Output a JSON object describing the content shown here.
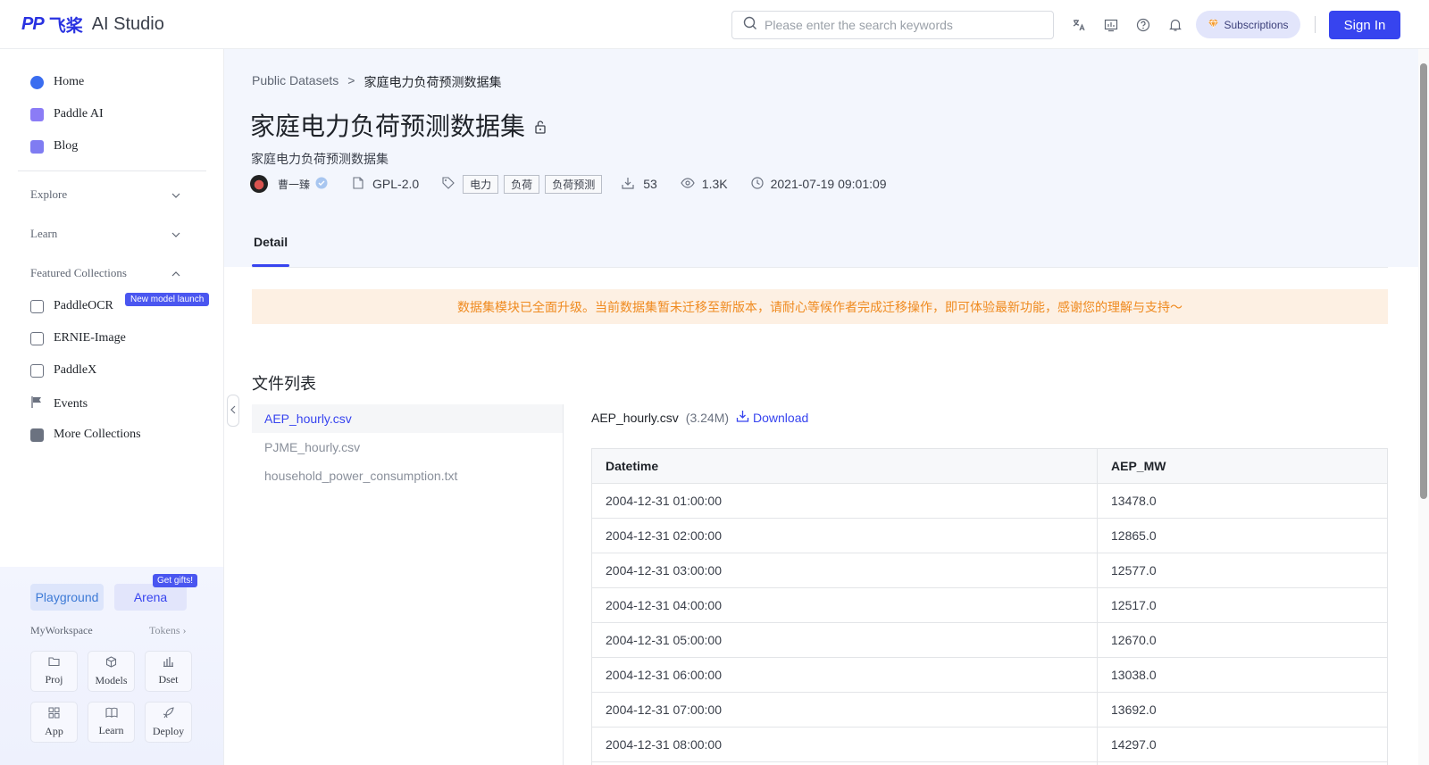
{
  "header": {
    "logo_mark": "PP",
    "logo_cn": "飞桨",
    "logo_studio": "AI Studio",
    "search_placeholder": "Please enter the search keywords",
    "subscriptions_label": "Subscriptions",
    "signin_label": "Sign In"
  },
  "sidebar": {
    "top_items": [
      {
        "label": "Home",
        "icon": "home-icon",
        "color": "#3a6df0"
      },
      {
        "label": "Paddle AI",
        "icon": "paddle-ai-icon",
        "color": "#7b6cf6"
      },
      {
        "label": "Blog",
        "icon": "blog-icon",
        "color": "#6f6cf0"
      }
    ],
    "sections": [
      {
        "label": "Explore",
        "expanded": false
      },
      {
        "label": "Learn",
        "expanded": false
      },
      {
        "label": "Featured Collections",
        "expanded": true
      }
    ],
    "collections": [
      {
        "label": "PaddleOCR",
        "icon": "ocr-icon",
        "badge": "New model launch"
      },
      {
        "label": "ERNIE-Image",
        "icon": "image-icon"
      },
      {
        "label": "PaddleX",
        "icon": "paddlex-icon"
      },
      {
        "label": "Events",
        "icon": "flag-icon"
      },
      {
        "label": "More Collections",
        "icon": "collections-icon"
      }
    ],
    "playground_label": "Playground",
    "arena_label": "Arena",
    "gifts_badge": "Get gifts!",
    "workspace_label": "MyWorkspace",
    "tokens_label": "Tokens",
    "tiles": [
      {
        "label": "Proj",
        "icon": "folder-icon"
      },
      {
        "label": "Models",
        "icon": "cube-icon"
      },
      {
        "label": "Dset",
        "icon": "bar-chart-icon"
      },
      {
        "label": "App",
        "icon": "apps-icon"
      },
      {
        "label": "Learn",
        "icon": "book-icon"
      },
      {
        "label": "Deploy",
        "icon": "rocket-icon"
      }
    ]
  },
  "dataset": {
    "breadcrumb_root": "Public Datasets",
    "breadcrumb_sep": ">",
    "breadcrumb_current": "家庭电力负荷预测数据集",
    "title": "家庭电力负荷预测数据集",
    "subtitle": "家庭电力负荷预测数据集",
    "author": "曹一臻",
    "license": "GPL-2.0",
    "tags": [
      "电力",
      "负荷",
      "负荷预测"
    ],
    "downloads": "53",
    "views": "1.3K",
    "updated": "2021-07-19 09:01:09"
  },
  "tabs": [
    {
      "label": "Detail",
      "active": true
    }
  ],
  "notice": "数据集模块已全面升级。当前数据集暂未迁移至新版本，请耐心等候作者完成迁移操作，即可体验最新功能，感谢您的理解与支持～",
  "files": {
    "heading": "文件列表",
    "items": [
      "AEP_hourly.csv",
      "PJME_hourly.csv",
      "household_power_consumption.txt"
    ],
    "active_index": 0
  },
  "preview": {
    "file_name": "AEP_hourly.csv",
    "file_size": "(3.24M)",
    "download_label": "Download",
    "columns": [
      "Datetime",
      "AEP_MW"
    ],
    "rows": [
      [
        "2004-12-31 01:00:00",
        "13478.0"
      ],
      [
        "2004-12-31 02:00:00",
        "12865.0"
      ],
      [
        "2004-12-31 03:00:00",
        "12577.0"
      ],
      [
        "2004-12-31 04:00:00",
        "12517.0"
      ],
      [
        "2004-12-31 05:00:00",
        "12670.0"
      ],
      [
        "2004-12-31 06:00:00",
        "13038.0"
      ],
      [
        "2004-12-31 07:00:00",
        "13692.0"
      ],
      [
        "2004-12-31 08:00:00",
        "14297.0"
      ],
      [
        "",
        ""
      ]
    ]
  }
}
